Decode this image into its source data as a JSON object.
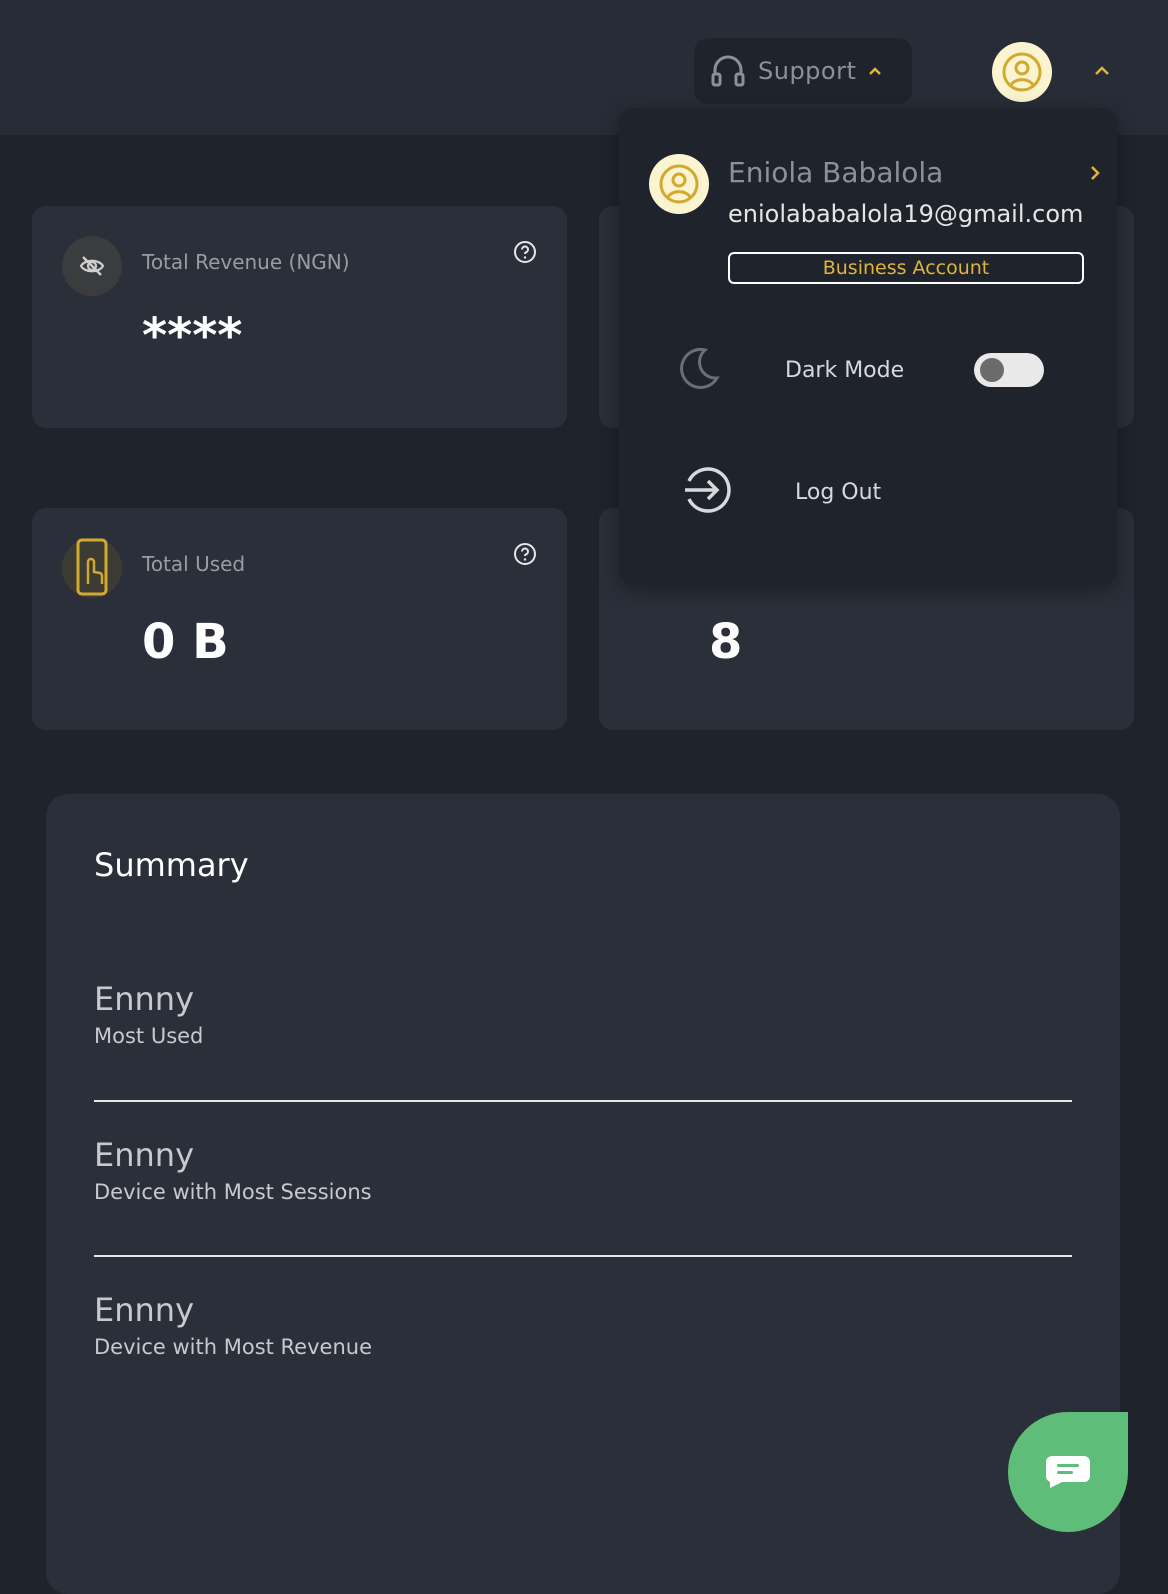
{
  "header": {
    "support_label": "Support"
  },
  "cards": [
    {
      "label": "Total Revenue (NGN)",
      "value": "****"
    },
    {
      "label": "Total Used",
      "value": "0 B"
    },
    {
      "value": "8"
    }
  ],
  "summary": {
    "title": "Summary",
    "items": [
      {
        "name": "Ennny",
        "desc": "Most Used"
      },
      {
        "name": "Ennny",
        "desc": "Device with Most Sessions"
      },
      {
        "name": "Ennny",
        "desc": "Device with Most Revenue"
      }
    ]
  },
  "profile_menu": {
    "name": "Eniola Babalola",
    "email": "eniolababalola19@gmail.com",
    "account_type": "Business Account",
    "dark_mode_label": "Dark Mode",
    "dark_mode_on": false,
    "logout_label": "Log Out"
  },
  "colors": {
    "accent": "#e0b53a",
    "chat": "#5ebd78",
    "card_bg": "#2a2f39",
    "page_bg": "#1f232c"
  },
  "icons": [
    "headphones-icon",
    "chevron-up-icon",
    "user-circle-icon",
    "eye-off-icon",
    "help-icon",
    "touch-phone-icon",
    "chevron-right-icon",
    "moon-icon",
    "logout-icon",
    "chat-icon"
  ]
}
